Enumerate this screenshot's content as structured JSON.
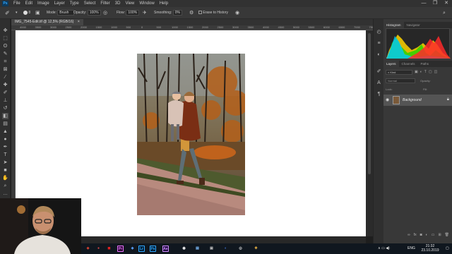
{
  "app": {
    "logo": "Ps",
    "icon": "photoshop-logo-icon"
  },
  "menu": {
    "items": [
      "File",
      "Edit",
      "Image",
      "Layer",
      "Type",
      "Select",
      "Filter",
      "3D",
      "View",
      "Window",
      "Help"
    ],
    "window_controls": [
      "—",
      "❐",
      "✕"
    ]
  },
  "options": {
    "brush_size": "8",
    "mode_label": "Mode:",
    "mode_value": "Brush",
    "opacity_label": "Opacity:",
    "opacity_value": "100%",
    "flow_label": "Flow:",
    "flow_value": "100%",
    "smoothing_label": "Smoothing:",
    "smoothing_value": "0%",
    "erase_label": "Erase to History"
  },
  "document": {
    "tab": "IMG_7545-Edit.tif @ 12,5% (RGB/16)",
    "close": "×",
    "ruler_ticks": [
      "4000",
      "3500",
      "3000",
      "2500",
      "2000",
      "1500",
      "1000",
      "500",
      "0",
      "500",
      "1000",
      "1500",
      "2000",
      "2500",
      "3000",
      "3500",
      "4000",
      "4500",
      "5000",
      "5500",
      "6000",
      "6500",
      "7000",
      "750"
    ]
  },
  "panels": {
    "top_tabs": [
      "Histogram",
      "Navigator"
    ],
    "layer_tabs": [
      "Layers",
      "Channels",
      "Paths"
    ],
    "kind_label": "Kind",
    "blend_mode": "Normal",
    "opacity_label": "Opacity:",
    "fill_label": "Fill:",
    "lock_label": "Lock:",
    "layer_name": "Background",
    "histogram_colors": [
      "#ffd400",
      "#2ad200",
      "#00c8ff",
      "#ff2a2a",
      "#ffffff"
    ]
  },
  "taskbar": {
    "apps": [
      {
        "label": "Lr",
        "color": "#31a8ff",
        "bg": "#001e36",
        "icon": "lightroom-icon"
      },
      {
        "label": "Ps",
        "color": "#31a8ff",
        "bg": "#001e36",
        "icon": "photoshop-icon"
      },
      {
        "label": "Pr",
        "color": "#ea77ff",
        "bg": "#2a0634",
        "icon": "premiere-icon"
      },
      {
        "label": "Ae",
        "color": "#d291ff",
        "bg": "#1f0740",
        "icon": "after-effects-icon"
      }
    ],
    "lang": "ENG",
    "time": "21:32",
    "date": "23.10.2019"
  }
}
